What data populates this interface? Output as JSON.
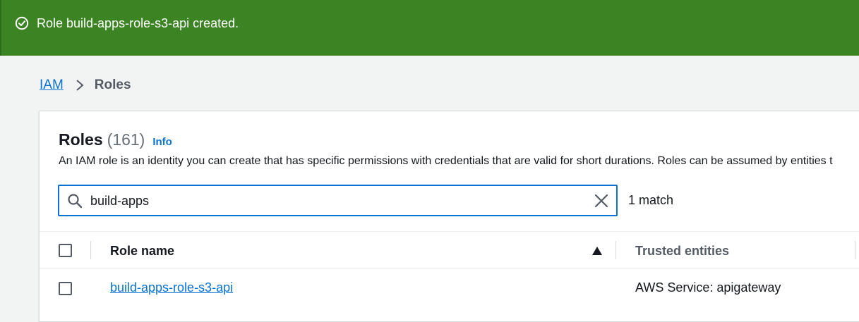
{
  "flash": {
    "message": "Role build-apps-role-s3-api created.",
    "color": "#3b8323",
    "icon": "check-circle-icon"
  },
  "breadcrumb": {
    "parent": "IAM",
    "current": "Roles"
  },
  "panel": {
    "title": "Roles",
    "count": "(161)",
    "info": "Info",
    "description": "An IAM role is an identity you can create that has specific permissions with credentials that are valid for short durations. Roles can be assumed by entities t"
  },
  "search": {
    "value": "build-apps",
    "match": "1 match"
  },
  "table": {
    "columns": [
      "Role name",
      "Trusted entities"
    ],
    "rows": [
      {
        "role_name": "build-apps-role-s3-api",
        "trusted_entities": "AWS Service: apigateway"
      }
    ]
  },
  "colors": {
    "link": "#0972d3",
    "focus_border": "#0972d3"
  }
}
